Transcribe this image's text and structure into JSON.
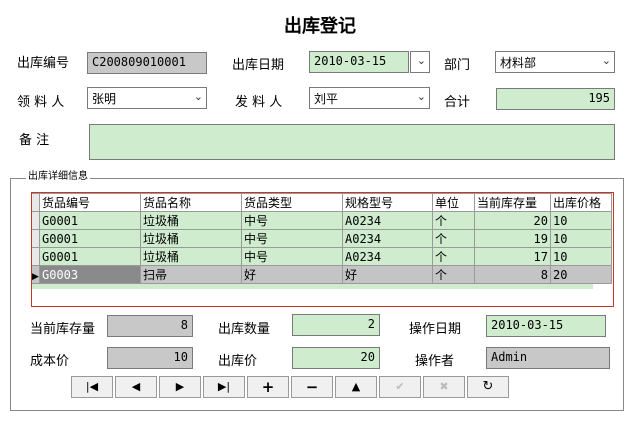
{
  "title": "出库登记",
  "header": {
    "no_label": "出库编号",
    "no_value": "C200809010001",
    "date_label": "出库日期",
    "date_value": "2010-03-15",
    "dept_label": "部门",
    "dept_value": "材料部",
    "receiver_label": "领 料 人",
    "receiver_value": "张明",
    "sender_label": "发 料 人",
    "sender_value": "刘平",
    "total_label": "合计",
    "total_value": "195",
    "remark_label": "备 注",
    "remark_value": ""
  },
  "group_title": "出库详细信息",
  "grid": {
    "columns": [
      "货品编号",
      "货品名称",
      "货品类型",
      "规格型号",
      "单位",
      "当前库存量",
      "出库价格"
    ],
    "rows": [
      [
        "G0001",
        "垃圾桶",
        "中号",
        "A0234",
        "个",
        "20",
        "10"
      ],
      [
        "G0001",
        "垃圾桶",
        "中号",
        "A0234",
        "个",
        "19",
        "10"
      ],
      [
        "G0001",
        "垃圾桶",
        "中号",
        "A0234",
        "个",
        "17",
        "10"
      ],
      [
        "G0003",
        "扫帚",
        "好",
        "好",
        "个",
        "8",
        "20"
      ]
    ],
    "selected_row": 3
  },
  "detail": {
    "stock_label": "当前库存量",
    "stock_value": "8",
    "qty_label": "出库数量",
    "qty_value": "2",
    "opdate_label": "操作日期",
    "opdate_value": "2010-03-15",
    "cost_label": "成本价",
    "cost_value": "10",
    "price_label": "出库价",
    "price_value": "20",
    "operator_label": "操作者",
    "operator_value": "Admin"
  },
  "nav": {
    "first": "first-record-icon",
    "prev": "prev-record-icon",
    "next": "next-record-icon",
    "last": "last-record-icon",
    "add": "add-icon",
    "delete": "delete-icon",
    "edit": "edit-icon",
    "post": "post-icon",
    "cancel": "cancel-icon",
    "refresh": "refresh-icon"
  }
}
